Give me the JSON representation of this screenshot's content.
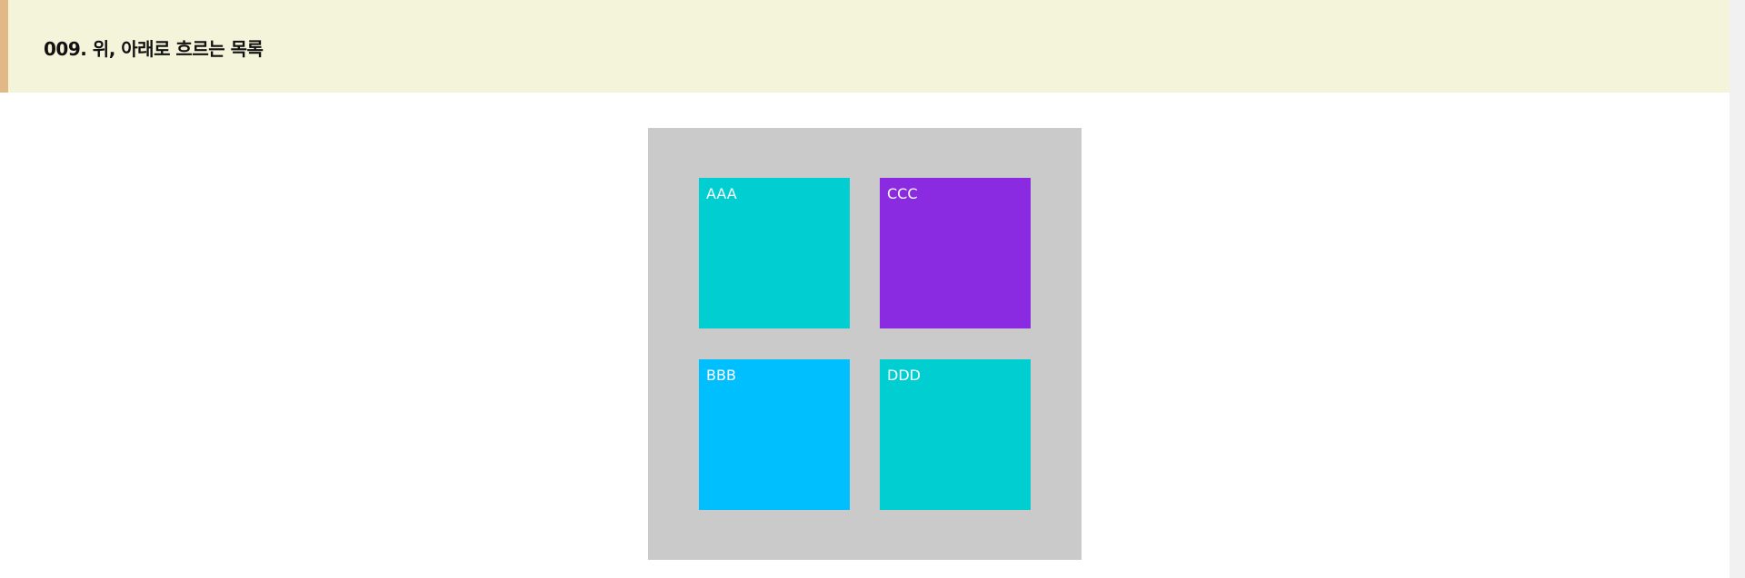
{
  "header": {
    "title": "009. 위, 아래로 흐르는 목록"
  },
  "items": [
    {
      "label": "AAA",
      "color": "#00ced1"
    },
    {
      "label": "BBB",
      "color": "#00bfff"
    },
    {
      "label": "CCC",
      "color": "#8a2be2"
    },
    {
      "label": "DDD",
      "color": "#00ced1"
    }
  ],
  "colors": {
    "header_background": "#f4f4db",
    "header_accent": "#e2b886",
    "container_background": "#cacaca"
  }
}
